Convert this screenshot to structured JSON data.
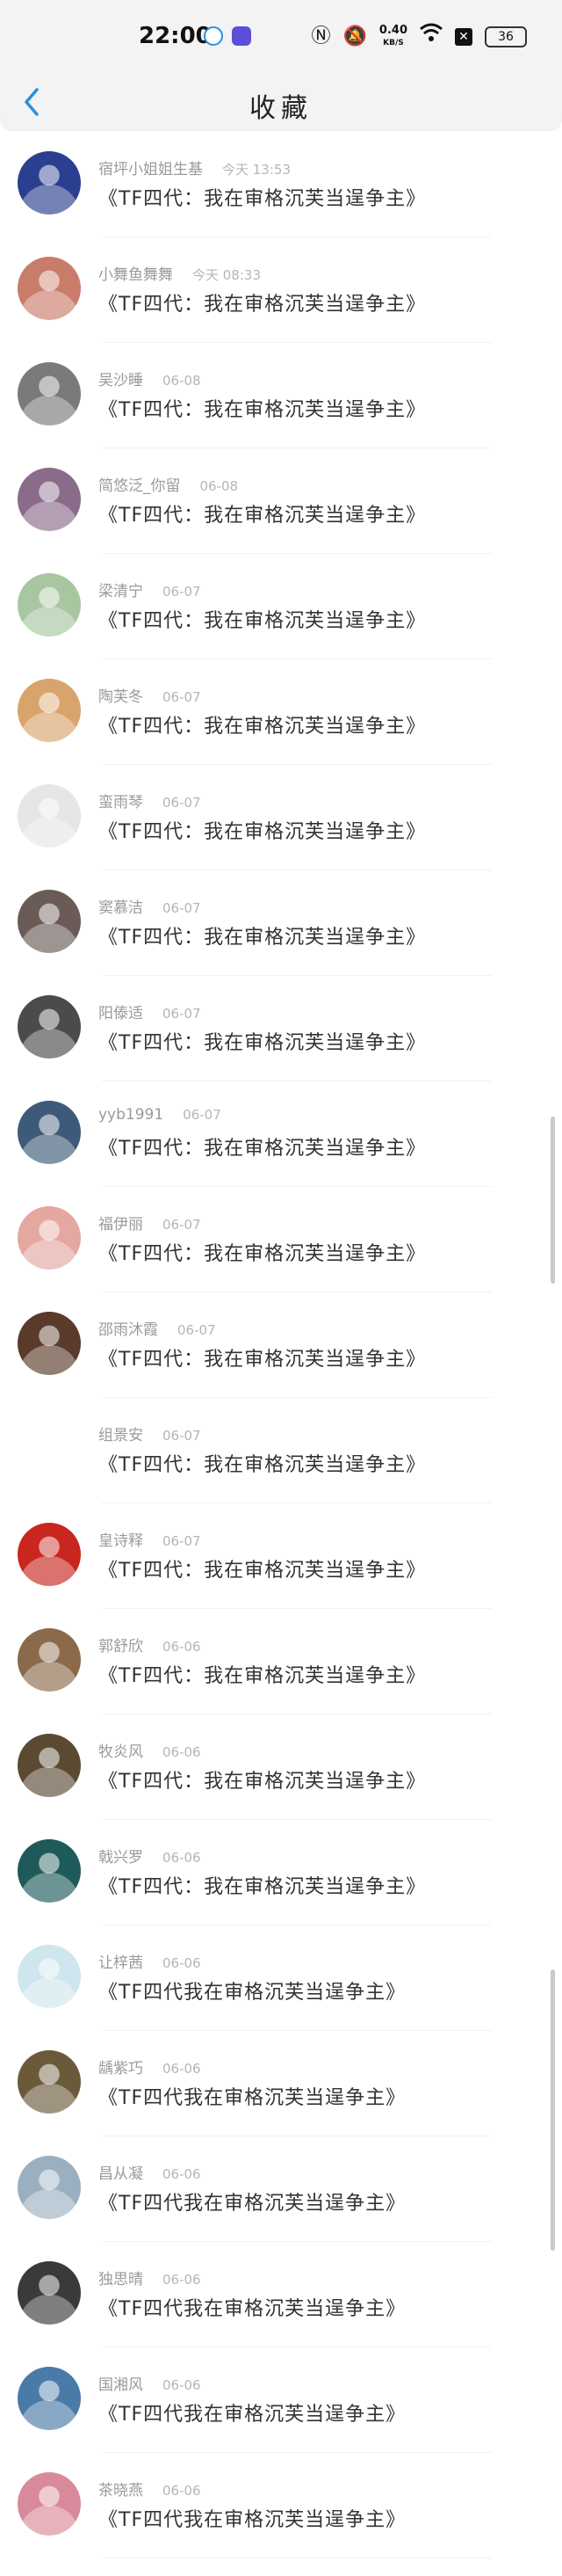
{
  "status_bar": {
    "time": "22:00",
    "net_speed_value": "0.40",
    "net_speed_unit": "KB/S",
    "battery": "36"
  },
  "header": {
    "title": "收藏"
  },
  "favorites": [
    {
      "name": "宿坪小姐姐生基",
      "time": "今天 13:53",
      "content": "《TF四代：我在审格沉芙当逞争主》",
      "avatar_color": "#2a3f8f"
    },
    {
      "name": "小舞鱼舞舞",
      "time": "今天 08:33",
      "content": "《TF四代：我在审格沉芙当逞争主》",
      "avatar_color": "#c97c6a"
    },
    {
      "name": "吴沙睡",
      "time": "06-08",
      "content": "《TF四代：我在审格沉芙当逞争主》",
      "avatar_color": "#7a7a7a"
    },
    {
      "name": "简悠泛_你留",
      "time": "06-08",
      "content": "《TF四代：我在审格沉芙当逞争主》",
      "avatar_color": "#8a6b8a"
    },
    {
      "name": "梁清宁",
      "time": "06-07",
      "content": "《TF四代：我在审格沉芙当逞争主》",
      "avatar_color": "#a8c6a0"
    },
    {
      "name": "陶芙冬",
      "time": "06-07",
      "content": "《TF四代：我在审格沉芙当逞争主》",
      "avatar_color": "#d9a46c"
    },
    {
      "name": "蛮雨琴",
      "time": "06-07",
      "content": "《TF四代：我在审格沉芙当逞争主》",
      "avatar_color": "#e6e6e6"
    },
    {
      "name": "窦慕洁",
      "time": "06-07",
      "content": "《TF四代：我在审格沉芙当逞争主》",
      "avatar_color": "#6a5b56"
    },
    {
      "name": "阳傣适",
      "time": "06-07",
      "content": "《TF四代：我在审格沉芙当逞争主》",
      "avatar_color": "#4b4b4b"
    },
    {
      "name": "yyb1991",
      "time": "06-07",
      "content": "《TF四代：我在审格沉芙当逞争主》",
      "avatar_color": "#3d5a7a"
    },
    {
      "name": "福伊丽",
      "time": "06-07",
      "content": "《TF四代：我在审格沉芙当逞争主》",
      "avatar_color": "#e4a8a0"
    },
    {
      "name": "邵雨沐霞",
      "time": "06-07",
      "content": "《TF四代：我在审格沉芙当逞争主》",
      "avatar_color": "#5a3a2a"
    },
    {
      "name": "组景安",
      "time": "06-07",
      "content": "《TF四代：我在审格沉芙当逞争主》",
      "avatar_color": "#ffffff"
    },
    {
      "name": "皇诗释",
      "time": "06-07",
      "content": "《TF四代：我在审格沉芙当逞争主》",
      "avatar_color": "#c8261f"
    },
    {
      "name": "郭舒欣",
      "time": "06-06",
      "content": "《TF四代：我在审格沉芙当逞争主》",
      "avatar_color": "#8a6a4a"
    },
    {
      "name": "牧炎风",
      "time": "06-06",
      "content": "《TF四代：我在审格沉芙当逞争主》",
      "avatar_color": "#5a4a32"
    },
    {
      "name": "戟兴罗",
      "time": "06-06",
      "content": "《TF四代：我在审格沉芙当逞争主》",
      "avatar_color": "#1f5a5a"
    },
    {
      "name": "让梓茜",
      "time": "06-06",
      "content": "《TF四代我在审格沉芙当逞争主》",
      "avatar_color": "#cfe6ee"
    },
    {
      "name": "龋紫巧",
      "time": "06-06",
      "content": "《TF四代我在审格沉芙当逞争主》",
      "avatar_color": "#6b5a3a"
    },
    {
      "name": "昌从凝",
      "time": "06-06",
      "content": "《TF四代我在审格沉芙当逞争主》",
      "avatar_color": "#9ab0c0"
    },
    {
      "name": "独思晴",
      "time": "06-06",
      "content": "《TF四代我在审格沉芙当逞争主》",
      "avatar_color": "#3a3a3a"
    },
    {
      "name": "国湘风",
      "time": "06-06",
      "content": "《TF四代我在审格沉芙当逞争主》",
      "avatar_color": "#4a7aa8"
    },
    {
      "name": "茶晓燕",
      "time": "06-06",
      "content": "《TF四代我在审格沉芙当逞争主》",
      "avatar_color": "#d98a9a"
    }
  ]
}
